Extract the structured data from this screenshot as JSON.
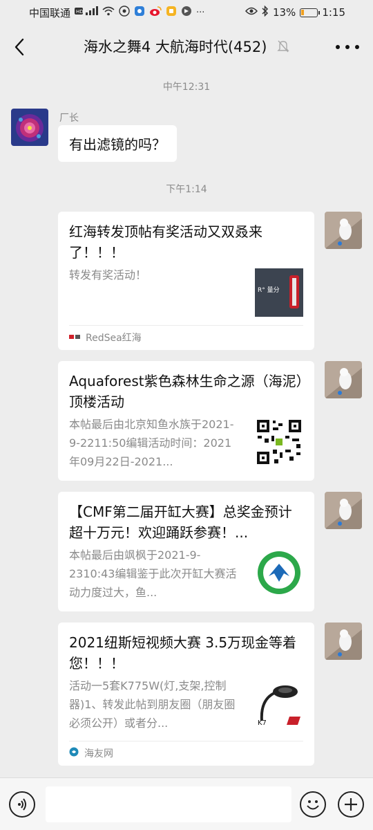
{
  "status_bar": {
    "carrier": "中国联通",
    "signal": "HD 4G",
    "battery_percent": "13%",
    "time": "1:15"
  },
  "header": {
    "title": "海水之舞4 大航海时代(452)"
  },
  "messages": {
    "time_1": "中午12:31",
    "sender_1": "厂长",
    "text_1": "有出滤镜的吗？",
    "time_2": "下午1:14"
  },
  "cards": [
    {
      "title": "红海转发顶帖有奖活动又双叒来了！！！",
      "desc": "转发有奖活动！",
      "thumb_text": "R° 量分",
      "source": "RedSea红海"
    },
    {
      "title": "Aquaforest紫色森林生命之源（海泥）顶楼活动",
      "desc": "本帖最后由北京知鱼水族于2021-9-2211:50编辑活动时间：2021年09月22日-2021...",
      "source": ""
    },
    {
      "title": "【CMF第二届开缸大赛】总奖金预计超十万元！欢迎踊跃参赛！...",
      "desc": "本帖最后由飒枫于2021-9-2310:43编辑鉴于此次开缸大赛活动力度过大，鱼...",
      "source": ""
    },
    {
      "title": "2021纽斯短视频大赛 3.5万现金等着您！！！",
      "desc": "活动一5套K775W(灯,支架,控制器)1、转发此帖到朋友圈（朋友圈必须公开）或者分...",
      "thumb_text": "K7",
      "source": "海友网"
    }
  ],
  "input": {
    "placeholder": ""
  },
  "colors": {
    "background": "#ededed",
    "bubble": "#ffffff",
    "muted_text": "#8a8a8a"
  }
}
